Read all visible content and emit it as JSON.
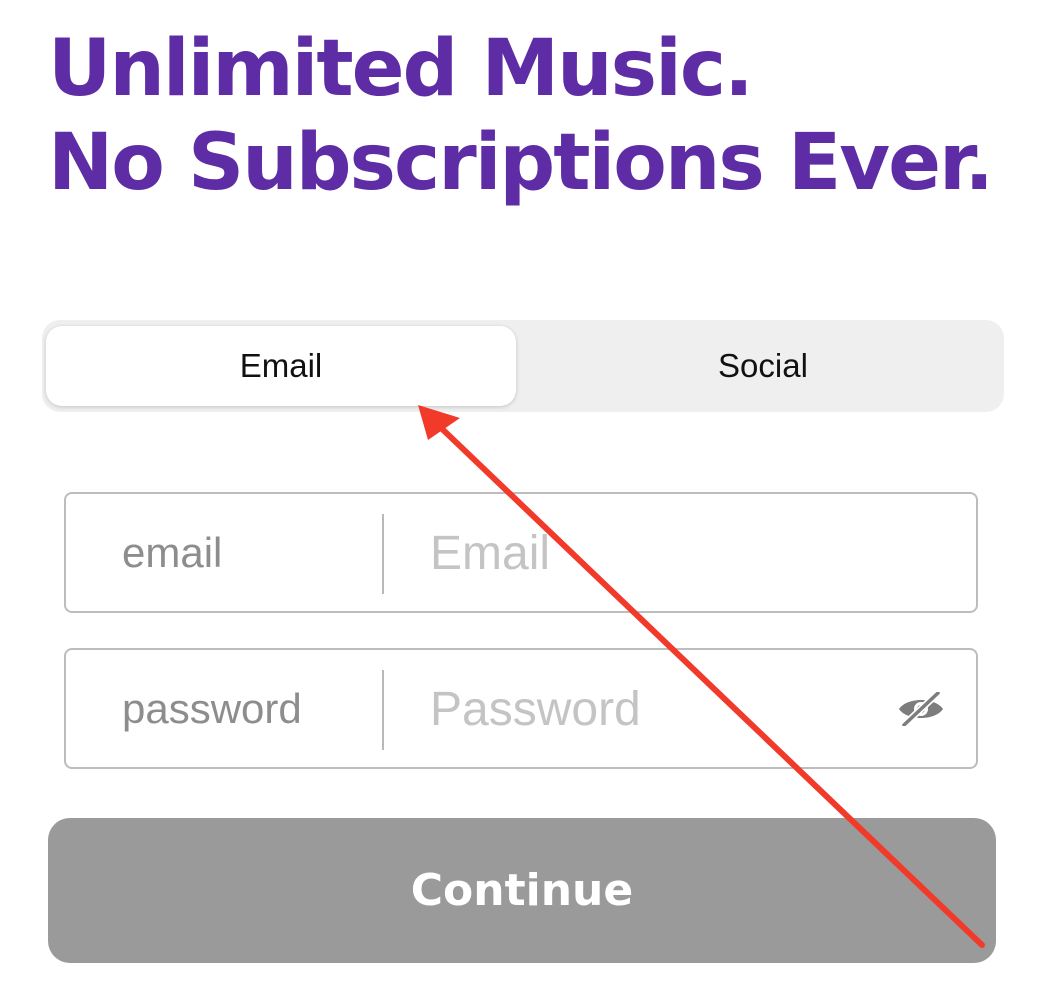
{
  "headline": {
    "line1": "Unlimited Music.",
    "line2": "No Subscriptions Ever."
  },
  "tabs": {
    "email_label": "Email",
    "social_label": "Social",
    "selected": "Email"
  },
  "form": {
    "email": {
      "label": "email",
      "placeholder": "Email",
      "value": ""
    },
    "password": {
      "label": "password",
      "placeholder": "Password",
      "value": "",
      "toggle_icon": "eye-slash-icon"
    }
  },
  "continue_label": "Continue",
  "colors": {
    "headline": "#5e2ca5",
    "button_disabled": "#9a9a9a",
    "annotation_arrow": "#f23a2a"
  }
}
